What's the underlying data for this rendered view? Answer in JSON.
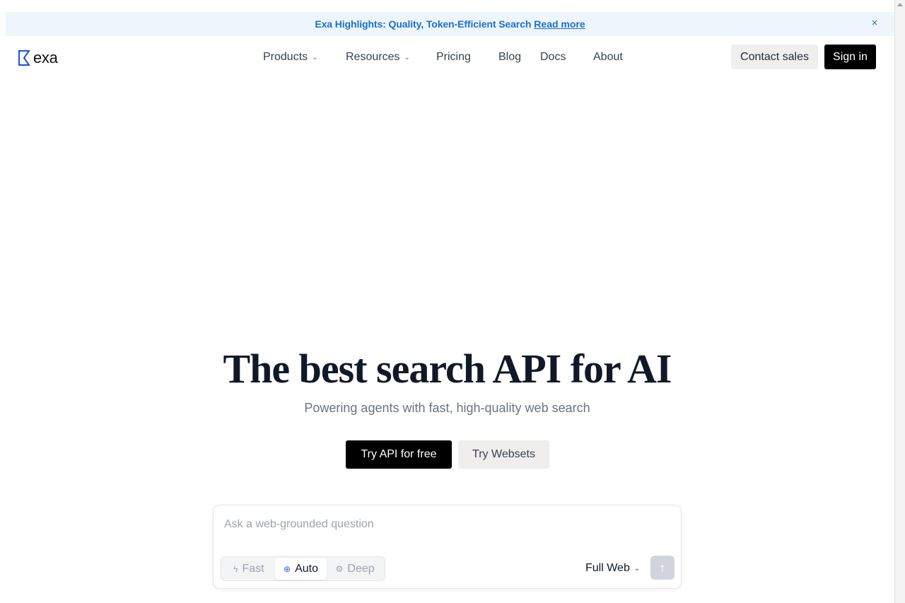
{
  "banner": {
    "text": "Exa Highlights: Quality, Token-Efficient Search",
    "link": "Read more",
    "close_glyph": "×"
  },
  "logo": {
    "word": "exa"
  },
  "nav": {
    "products": "Products",
    "resources": "Resources",
    "pricing": "Pricing",
    "blog": "Blog",
    "docs": "Docs",
    "about": "About",
    "chevron_glyph": "⌄"
  },
  "header_actions": {
    "contact": "Contact sales",
    "signin": "Sign in"
  },
  "hero": {
    "title": "The best search API for AI",
    "subtitle": "Powering agents with fast, high-quality web search",
    "cta_primary": "Try API for free",
    "cta_secondary": "Try Websets"
  },
  "search": {
    "placeholder": "Ask a web-grounded question",
    "value": "",
    "modes": [
      {
        "label": "Fast",
        "icon": "lightning-icon",
        "glyph": "ϟ"
      },
      {
        "label": "Auto",
        "icon": "globe-icon",
        "glyph": "⊕",
        "selected": true
      },
      {
        "label": "Deep",
        "icon": "gear-icon",
        "glyph": "⚙"
      }
    ],
    "scope": "Full Web",
    "scope_chevron": "⌄",
    "submit_glyph": "↑"
  },
  "colors": {
    "accent": "#1c6fd0",
    "banner_bg": "#eef6fc",
    "primary_button": "#000000"
  }
}
